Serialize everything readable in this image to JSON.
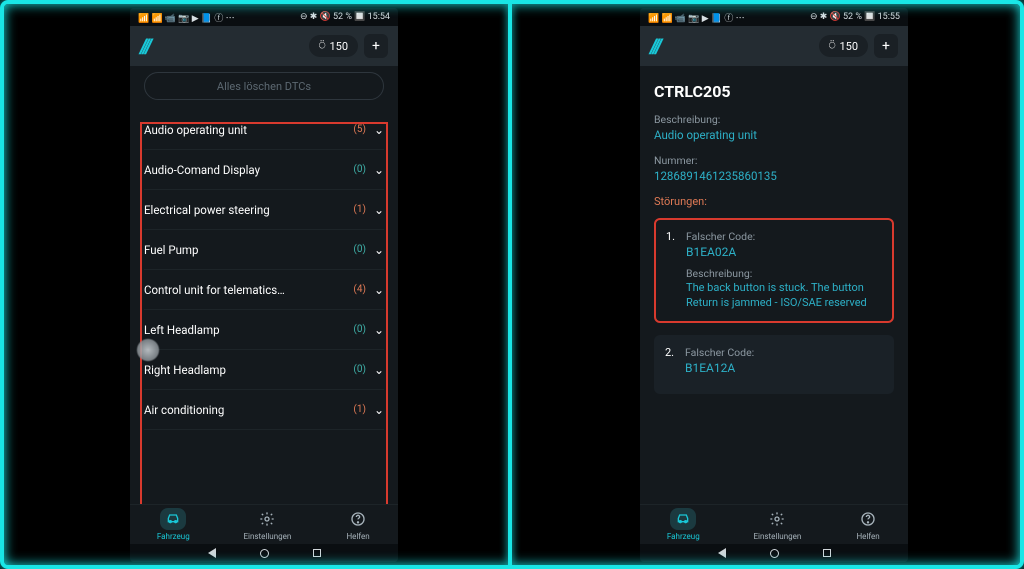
{
  "status_bar": {
    "left_icons": "📶 📶 📹 📷 ▶ 📘 ⓕ ⋯",
    "right_left": "⊖ ✱ 🔇 52 % 🔲 15:54",
    "right_right": "⊖ ✱ 🔇 52 % 🔲 15:55"
  },
  "header": {
    "logo": "///",
    "credits": "150",
    "plus": "+",
    "link_icon": "⍥"
  },
  "left_screen": {
    "delete_all": "Alles löschen DTCs",
    "units": [
      {
        "label": "Audio operating unit",
        "count": "(5)",
        "count_class": "red"
      },
      {
        "label": "Audio-Comand Display",
        "count": "(0)",
        "count_class": "green"
      },
      {
        "label": "Electrical power steering",
        "count": "(1)",
        "count_class": "red"
      },
      {
        "label": "Fuel Pump",
        "count": "(0)",
        "count_class": "green"
      },
      {
        "label": "Control unit for telematics…",
        "count": "(4)",
        "count_class": "red"
      },
      {
        "label": "Left Headlamp",
        "count": "(0)",
        "count_class": "green"
      },
      {
        "label": "Right Headlamp",
        "count": "(0)",
        "count_class": "green"
      },
      {
        "label": "Air conditioning",
        "count": "(1)",
        "count_class": "red"
      }
    ]
  },
  "right_screen": {
    "title": "CTRLC205",
    "descr_label": "Beschreibung:",
    "descr_value": "Audio operating unit",
    "number_label": "Nummer:",
    "number_value": "1286891461235860135",
    "stoer_label": "Störungen:",
    "faults": [
      {
        "num": "1.",
        "code_label": "Falscher Code:",
        "code": "B1EA02A",
        "desc_label": "Beschreibung:",
        "desc": "The back button is stuck. The button Return is jammed - ISO/SAE reserved"
      },
      {
        "num": "2.",
        "code_label": "Falscher Code:",
        "code": "B1EA12A",
        "desc_label": "",
        "desc": ""
      }
    ]
  },
  "bottom_nav": {
    "items": [
      {
        "label": "Fahrzeug",
        "icon": "car"
      },
      {
        "label": "Einstellungen",
        "icon": "gear"
      },
      {
        "label": "Helfen",
        "icon": "help"
      }
    ]
  }
}
